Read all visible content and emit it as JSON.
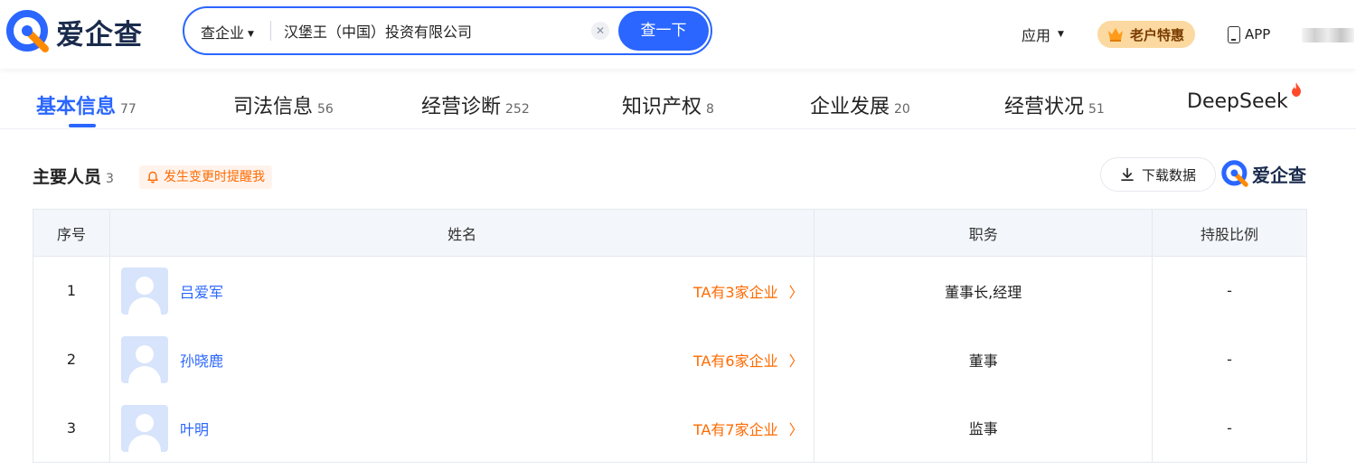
{
  "header": {
    "logo_text": "爱企查",
    "search": {
      "type_label": "查企业",
      "query": "汉堡王（中国）投资有限公司",
      "button_label": "查一下"
    },
    "apps_label": "应用",
    "vip_label": "老户特惠",
    "app_label": "APP"
  },
  "tabs": [
    {
      "label": "基本信息",
      "count": "77"
    },
    {
      "label": "司法信息",
      "count": "56"
    },
    {
      "label": "经营诊断",
      "count": "252"
    },
    {
      "label": "知识产权",
      "count": "8"
    },
    {
      "label": "企业发展",
      "count": "20"
    },
    {
      "label": "经营状况",
      "count": "51"
    },
    {
      "label": "DeepSeek",
      "count": ""
    }
  ],
  "section": {
    "title": "主要人员",
    "count": "3",
    "remind_label": "发生变更时提醒我",
    "download_label": "下载数据",
    "brand_label": "爱企查"
  },
  "table": {
    "headers": [
      "序号",
      "姓名",
      "职务",
      "持股比例"
    ],
    "rows": [
      {
        "index": "1",
        "name": "吕爱军",
        "link": "TA有3家企业",
        "position": "董事长,经理",
        "share": "-"
      },
      {
        "index": "2",
        "name": "孙晓鹿",
        "link": "TA有6家企业",
        "position": "董事",
        "share": "-"
      },
      {
        "index": "3",
        "name": "叶明",
        "link": "TA有7家企业",
        "position": "监事",
        "share": "-"
      }
    ]
  },
  "colors": {
    "accent": "#2a66ff",
    "orange": "#ff6a00",
    "vip_bg": "#fbd9a0"
  },
  "icons": [
    "logo-q-icon",
    "caret-down-icon",
    "clear-icon",
    "crown-icon",
    "phone-icon",
    "fire-icon",
    "bell-icon",
    "download-icon",
    "chevron-right-icon",
    "avatar-icon"
  ]
}
